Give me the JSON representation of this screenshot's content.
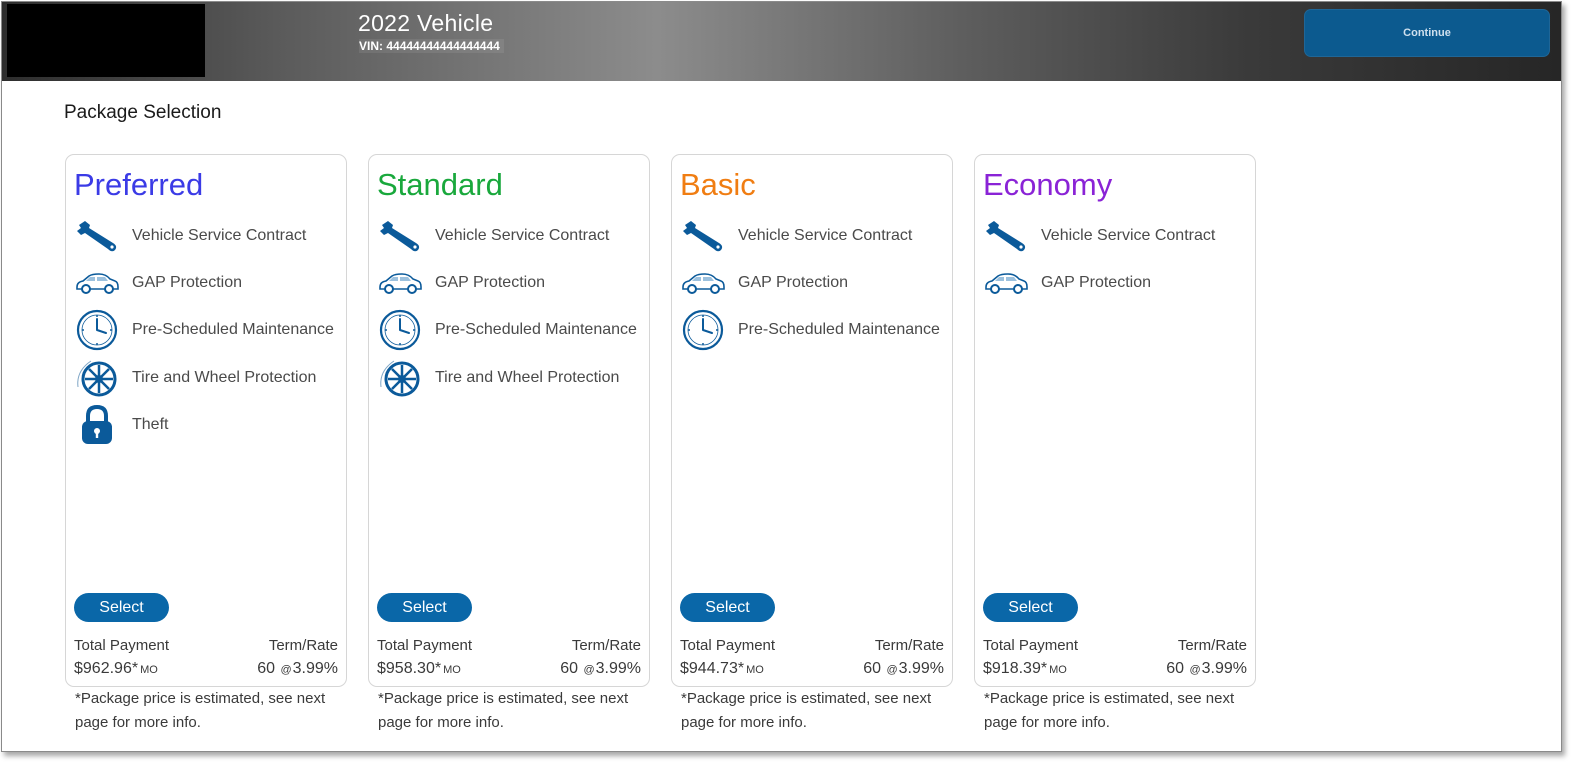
{
  "header": {
    "vehicle_title": "2022 Vehicle",
    "vin_label": "VIN:",
    "vin_value": "44444444444444444",
    "continue_label": "Continue"
  },
  "section_title": "Package Selection",
  "colors": {
    "preferred": "#3b3be6",
    "standard": "#19a83c",
    "basic": "#f07d12",
    "economy": "#8a23d6",
    "accent": "#0a67a8",
    "icon": "#0b5a9a"
  },
  "packages": [
    {
      "name": "Preferred",
      "features": [
        "Vehicle Service Contract",
        "GAP Protection",
        "Pre-Scheduled Maintenance",
        "Tire and Wheel Protection",
        "Theft"
      ],
      "select_label": "Select",
      "total_payment_label": "Total Payment",
      "term_rate_label": "Term/Rate",
      "payment": "$962.96*",
      "payment_unit": "MO",
      "term": "60",
      "rate_sep": "@",
      "rate": "3.99%",
      "footnote": "*Package price is estimated, see next page for more info."
    },
    {
      "name": "Standard",
      "features": [
        "Vehicle Service Contract",
        "GAP Protection",
        "Pre-Scheduled Maintenance",
        "Tire and Wheel Protection"
      ],
      "select_label": "Select",
      "total_payment_label": "Total Payment",
      "term_rate_label": "Term/Rate",
      "payment": "$958.30*",
      "payment_unit": "MO",
      "term": "60",
      "rate_sep": "@",
      "rate": "3.99%",
      "footnote": "*Package price is estimated, see next page for more info."
    },
    {
      "name": "Basic",
      "features": [
        "Vehicle Service Contract",
        "GAP Protection",
        "Pre-Scheduled Maintenance"
      ],
      "select_label": "Select",
      "total_payment_label": "Total Payment",
      "term_rate_label": "Term/Rate",
      "payment": "$944.73*",
      "payment_unit": "MO",
      "term": "60",
      "rate_sep": "@",
      "rate": "3.99%",
      "footnote": "*Package price is estimated, see next page for more info."
    },
    {
      "name": "Economy",
      "features": [
        "Vehicle Service Contract",
        "GAP Protection"
      ],
      "select_label": "Select",
      "total_payment_label": "Total Payment",
      "term_rate_label": "Term/Rate",
      "payment": "$918.39*",
      "payment_unit": "MO",
      "term": "60",
      "rate_sep": "@",
      "rate": "3.99%",
      "footnote": "*Package price is estimated, see next page for more info."
    }
  ],
  "feature_icons": [
    "wrench-icon",
    "car-icon",
    "clock-icon",
    "wheel-icon",
    "lock-icon"
  ]
}
